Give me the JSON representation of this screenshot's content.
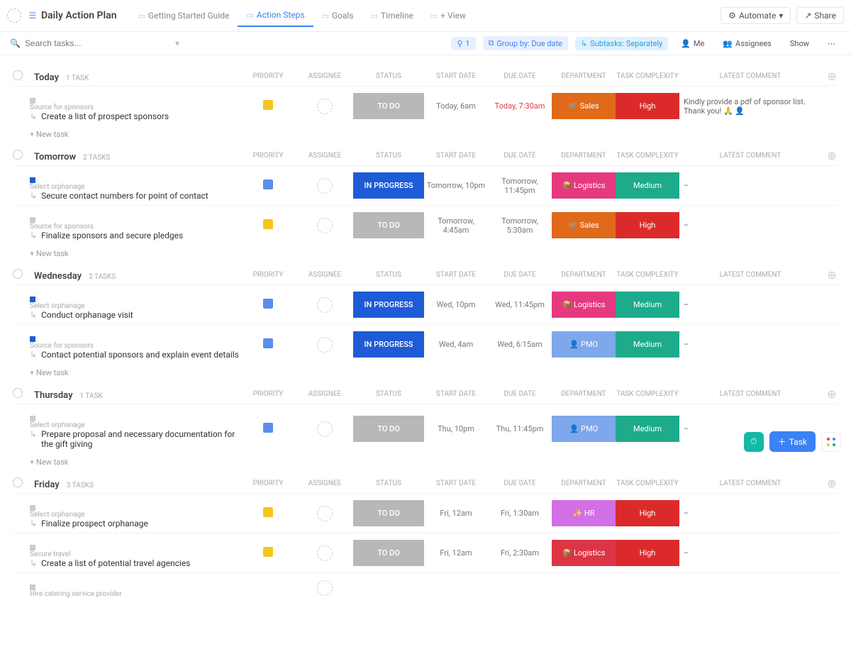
{
  "header": {
    "title": "Daily Action Plan",
    "tabs": [
      "Getting Started Guide",
      "Action Steps",
      "Goals",
      "Timeline",
      "+ View"
    ],
    "activeTab": 1,
    "automate": "Automate",
    "share": "Share"
  },
  "filters": {
    "searchPlaceholder": "Search tasks...",
    "count": "1",
    "groupBy": "Group by: Due date",
    "subtasks": "Subtasks: Separately",
    "me": "Me",
    "assignees": "Assignees",
    "show": "Show"
  },
  "columns": [
    "PRIORITY",
    "ASSIGNEE",
    "STATUS",
    "START DATE",
    "DUE DATE",
    "DEPARTMENT",
    "TASK COMPLEXITY",
    "LATEST COMMENT"
  ],
  "newTaskLabel": "+ New task",
  "groups": [
    {
      "day": "Today",
      "count": "1 TASK",
      "tasks": [
        {
          "sq": "gray",
          "parent": "Source for sponsors",
          "name": "Create a list of prospect sponsors",
          "flag": "#f5c518",
          "status": "TO DO",
          "sclass": "todo",
          "start": "Today, 6am",
          "due": "Today, 7:30am",
          "dueRed": true,
          "dept": "🛒 Sales",
          "dclass": "sales",
          "cx": "High",
          "cclass": "high",
          "comment": "Kindly provide a pdf of sponsor list. Thank you! 🙏 👤"
        }
      ]
    },
    {
      "day": "Tomorrow",
      "count": "2 TASKS",
      "tasks": [
        {
          "sq": "blue",
          "parent": "Select orphanage",
          "name": "Secure contact numbers for point of contact",
          "flag": "#5b8def",
          "status": "IN PROGRESS",
          "sclass": "prog",
          "start": "Tomorrow, 10pm",
          "due": "Tomorrow, 11:45pm",
          "dept": "📦 Logistics",
          "dclass": "log",
          "cx": "Medium",
          "cclass": "med",
          "comment": "–"
        },
        {
          "sq": "gray",
          "parent": "Source for sponsors",
          "name": "Finalize sponsors and secure pledges",
          "flag": "#f5c518",
          "status": "TO DO",
          "sclass": "todo",
          "start": "Tomorrow, 4:45am",
          "due": "Tomorrow, 5:30am",
          "dept": "🛒 Sales",
          "dclass": "sales",
          "cx": "High",
          "cclass": "high",
          "comment": "–"
        }
      ]
    },
    {
      "day": "Wednesday",
      "count": "2 TASKS",
      "tasks": [
        {
          "sq": "blue",
          "parent": "Select orphanage",
          "name": "Conduct orphanage visit",
          "flag": "#5b8def",
          "status": "IN PROGRESS",
          "sclass": "prog",
          "start": "Wed, 10pm",
          "due": "Wed, 11:45pm",
          "dept": "📦 Logistics",
          "dclass": "log",
          "cx": "Medium",
          "cclass": "med",
          "comment": "–"
        },
        {
          "sq": "blue",
          "parent": "Source for sponsors",
          "name": "Contact potential sponsors and explain event details",
          "flag": "#5b8def",
          "status": "IN PROGRESS",
          "sclass": "prog",
          "start": "Wed, 4am",
          "due": "Wed, 6:15am",
          "dept": "👤 PMO",
          "dclass": "pmo",
          "cx": "Medium",
          "cclass": "med",
          "comment": "–"
        }
      ]
    },
    {
      "day": "Thursday",
      "count": "1 TASK",
      "tasks": [
        {
          "sq": "gray",
          "parent": "Select orphanage",
          "name": "Prepare proposal and necessary documentation for the gift giving",
          "flag": "#5b8def",
          "status": "TO DO",
          "sclass": "todo",
          "start": "Thu, 10pm",
          "due": "Thu, 11:45pm",
          "dept": "👤 PMO",
          "dclass": "pmo",
          "cx": "Medium",
          "cclass": "med",
          "comment": "–"
        }
      ]
    },
    {
      "day": "Friday",
      "count": "3 TASKS",
      "tasks": [
        {
          "sq": "gray",
          "parent": "Select orphanage",
          "name": "Finalize prospect orphanage",
          "flag": "#f5c518",
          "status": "TO DO",
          "sclass": "todo",
          "start": "Fri, 12am",
          "due": "Fri, 1:30am",
          "dept": "✨ HR",
          "dclass": "hr",
          "cx": "High",
          "cclass": "high",
          "comment": "–"
        },
        {
          "sq": "gray",
          "parent": "Secure travel",
          "name": "Create a list of potential travel agencies",
          "flag": "#f5c518",
          "status": "TO DO",
          "sclass": "todo",
          "start": "Fri, 12am",
          "due": "Fri, 2:30am",
          "dept": "📦 Logistics",
          "dclass": "log2",
          "cx": "High",
          "cclass": "high",
          "comment": "–"
        },
        {
          "sq": "gray",
          "parent": "Hire catering service provider",
          "name": "",
          "flag": "",
          "status": "",
          "sclass": "",
          "start": "",
          "due": "",
          "dept": "",
          "dclass": "",
          "cx": "",
          "cclass": "",
          "comment": ""
        }
      ],
      "noNew": true
    }
  ],
  "fab": {
    "task": "Task"
  }
}
